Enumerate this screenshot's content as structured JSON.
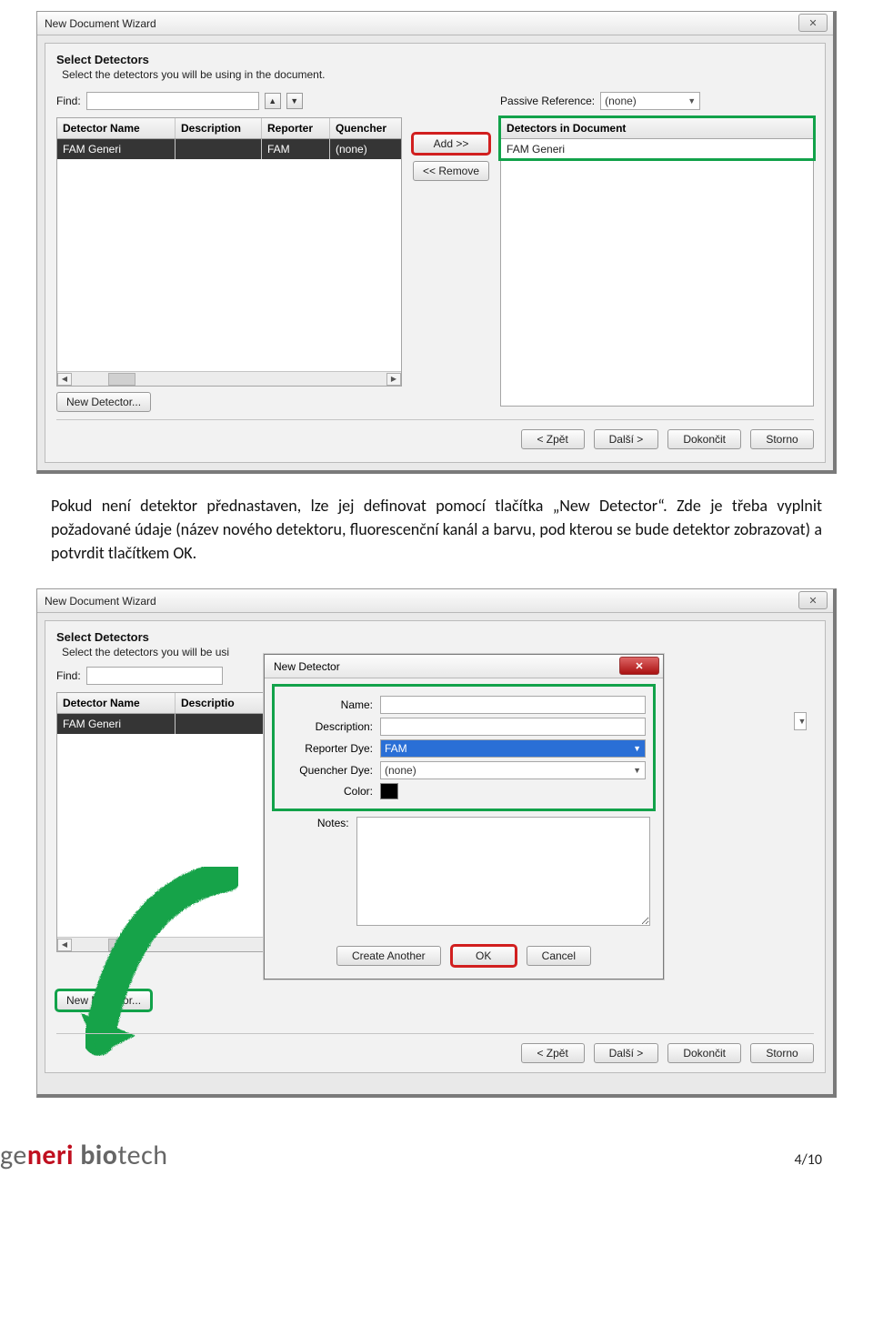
{
  "shot1": {
    "window_title": "New Document Wizard",
    "close_glyph": "✕",
    "section_title": "Select Detectors",
    "section_sub": "Select the detectors you will be using in the document.",
    "find_label": "Find:",
    "find_value": "",
    "passive_ref_label": "Passive Reference:",
    "passive_ref_value": "(none)",
    "left_headers": [
      "Detector Name",
      "Description",
      "Reporter",
      "Quencher"
    ],
    "left_row": {
      "name": "FAM Generi",
      "desc": "",
      "rep": "FAM",
      "que": "(none)"
    },
    "add_label": "Add >>",
    "remove_label": "<< Remove",
    "right_header": "Detectors in Document",
    "right_row": "FAM Generi",
    "new_detector_label": "New Detector...",
    "footer": {
      "back": "< Zpět",
      "next": "Další >",
      "finish": "Dokončit",
      "cancel": "Storno"
    }
  },
  "paragraph": "Pokud není detektor přednastaven, lze jej definovat pomocí tlačítka „New Detector“. Zde je třeba vyplnit požadované údaje (název nového detektoru, fluorescenční kanál a barvu, pod kterou se bude detektor zobrazovat) a potvrdit tlačítkem OK.",
  "shot2": {
    "window_title": "New Document Wizard",
    "section_title": "Select Detectors",
    "section_sub": "Select the detectors you will be usi",
    "find_label": "Find:",
    "left_headers": [
      "Detector Name",
      "Descriptio"
    ],
    "left_row_name": "FAM Generi",
    "new_detector_label": "New Detector...",
    "dialog_title": "New Detector",
    "name_label": "Name:",
    "name_value": "",
    "desc_label": "Description:",
    "desc_value": "",
    "rep_label": "Reporter Dye:",
    "rep_value": "FAM",
    "que_label": "Quencher Dye:",
    "que_value": "(none)",
    "color_label": "Color:",
    "notes_label": "Notes:",
    "create_another": "Create Another",
    "ok": "OK",
    "cancel": "Cancel",
    "footer": {
      "back": "< Zpět",
      "next": "Další >",
      "finish": "Dokončit",
      "cancel": "Storno"
    }
  },
  "footer_page": "4/10",
  "brand": {
    "a": "ge",
    "b": "neri ",
    "c": "bio",
    "d": "tech"
  }
}
